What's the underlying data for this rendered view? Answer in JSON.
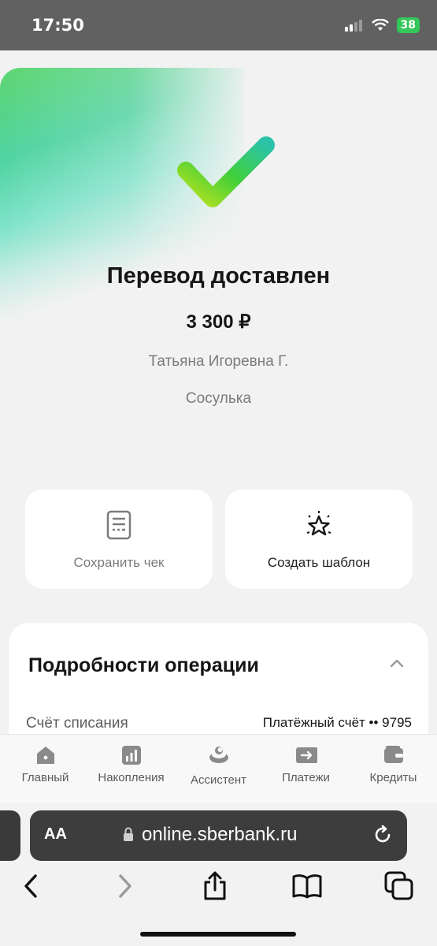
{
  "status_bar": {
    "time": "17:50",
    "battery": "38"
  },
  "receipt": {
    "title": "Перевод доставлен",
    "amount": "3 300 ₽",
    "recipient": "Татьяна Игоревна Г.",
    "bank": "Сосулька"
  },
  "actions": {
    "save_receipt": "Сохранить чек",
    "create_template": "Создать шаблон"
  },
  "details": {
    "title": "Подробности операции",
    "debit_label": "Счёт списания",
    "debit_value": "Платёжный счёт •• 9795"
  },
  "bottom_nav": [
    {
      "label": "Главный",
      "icon": "home-icon"
    },
    {
      "label": "Накопления",
      "icon": "chart-icon"
    },
    {
      "label": "Ассистент",
      "icon": "assistant-icon"
    },
    {
      "label": "Платежи",
      "icon": "payments-icon"
    },
    {
      "label": "Кредиты",
      "icon": "wallet-icon"
    }
  ],
  "browser": {
    "text_size_label": "AA",
    "url": "online.sberbank.ru"
  },
  "colors": {
    "brand_green": "#21a038",
    "battery_green": "#34c759"
  }
}
